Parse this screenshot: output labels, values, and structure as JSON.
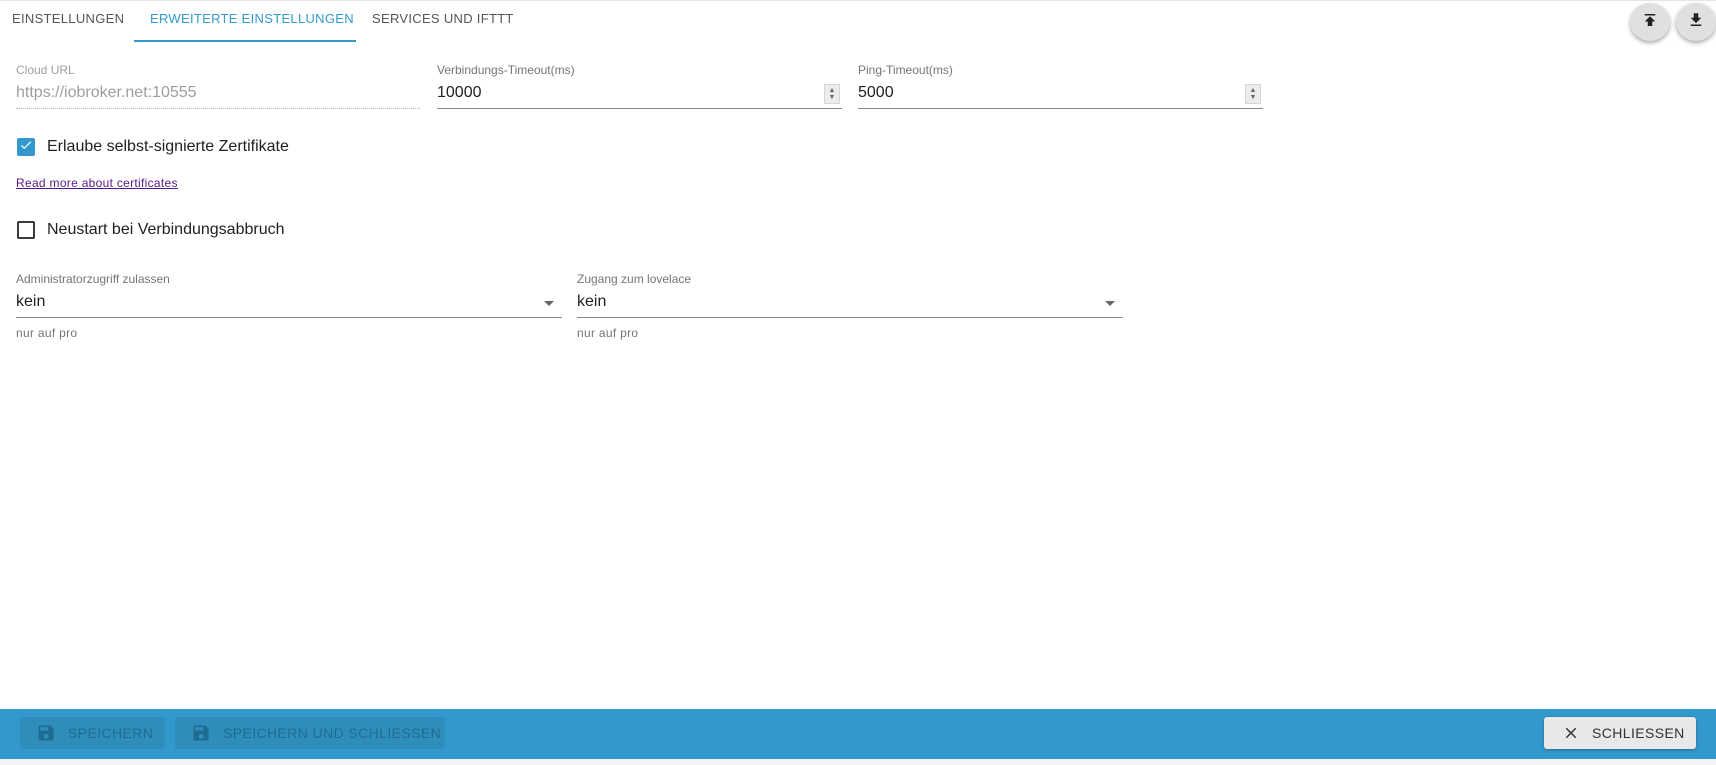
{
  "tabs": [
    {
      "label": "EINSTELLUNGEN",
      "active": false
    },
    {
      "label": "ERWEITERTE EINSTELLUNGEN",
      "active": true
    },
    {
      "label": "SERVICES UND IFTTT",
      "active": false
    }
  ],
  "actions": {
    "upload_icon": "upload-icon",
    "download_icon": "download-icon"
  },
  "fields": {
    "cloud_url": {
      "label": "Cloud URL",
      "value": "https://iobroker.net:10555",
      "disabled": true
    },
    "connection_timeout": {
      "label": "Verbindungs-Timeout(ms)",
      "value": "10000"
    },
    "ping_timeout": {
      "label": "Ping-Timeout(ms)",
      "value": "5000"
    }
  },
  "checkboxes": {
    "self_signed": {
      "label": "Erlaube selbst-signierte Zertifikate",
      "checked": true
    },
    "restart_on_disconnect": {
      "label": "Neustart bei Verbindungsabbruch",
      "checked": false
    }
  },
  "link": {
    "label": "Read more about certificates"
  },
  "selects": {
    "admin_access": {
      "label": "Administratorzugriff zulassen",
      "value": "kein",
      "helper": "nur auf pro"
    },
    "lovelace_access": {
      "label": "Zugang zum lovelace",
      "value": "kein",
      "helper": "nur auf pro"
    }
  },
  "footer": {
    "save_label": "SPEICHERN",
    "save_close_label": "SPEICHERN UND SCHLIESSEN",
    "close_label": "SCHLIESSEN"
  },
  "colors": {
    "accent": "#3399cc",
    "footer_bg": "#3399cc",
    "link": "#551a8b"
  }
}
